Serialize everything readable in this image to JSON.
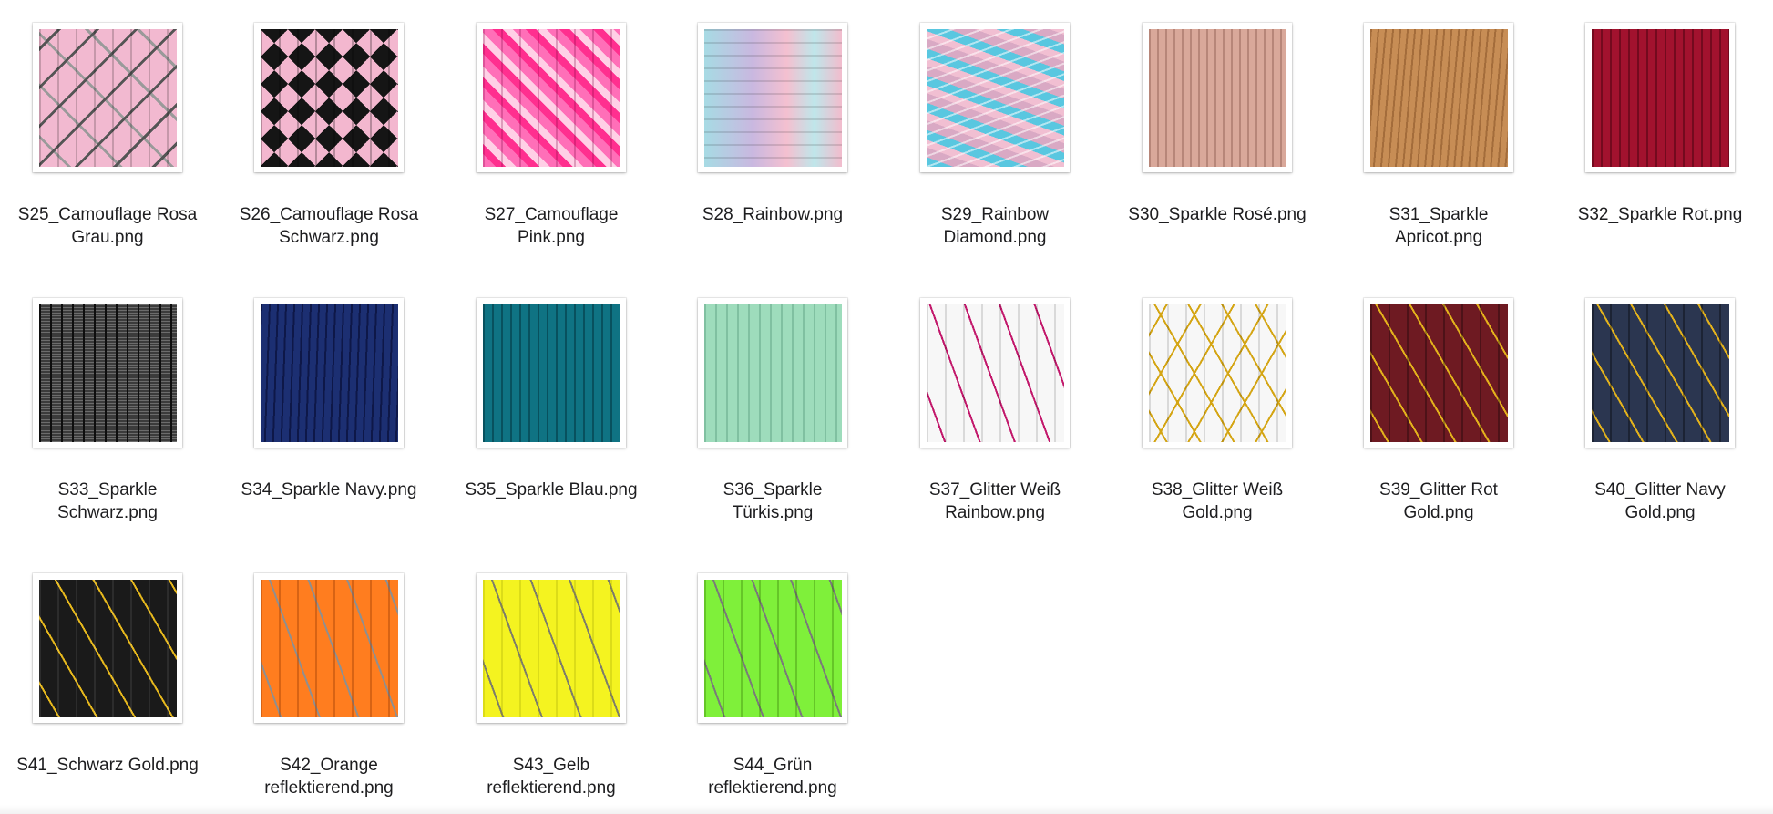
{
  "files": [
    {
      "name": "S25_Camouflage Rosa\nGrau.png",
      "thumbnail": "camouflage-rosa-grau-cord"
    },
    {
      "name": "S26_Camouflage Rosa\nSchwarz.png",
      "thumbnail": "camouflage-rosa-schwarz-cord"
    },
    {
      "name": "S27_Camouflage\nPink.png",
      "thumbnail": "camouflage-pink-cord"
    },
    {
      "name": "S28_Rainbow.png",
      "thumbnail": "rainbow-cord"
    },
    {
      "name": "S29_Rainbow\nDiamond.png",
      "thumbnail": "rainbow-diamond-cord"
    },
    {
      "name": "S30_Sparkle Rosé.png",
      "thumbnail": "sparkle-rose-cord"
    },
    {
      "name": "S31_Sparkle\nApricot.png",
      "thumbnail": "sparkle-apricot-cord"
    },
    {
      "name": "S32_Sparkle Rot.png",
      "thumbnail": "sparkle-rot-cord"
    },
    {
      "name": "S33_Sparkle\nSchwarz.png",
      "thumbnail": "sparkle-schwarz-cord"
    },
    {
      "name": "S34_Sparkle Navy.png",
      "thumbnail": "sparkle-navy-cord"
    },
    {
      "name": "S35_Sparkle Blau.png",
      "thumbnail": "sparkle-blau-cord"
    },
    {
      "name": "S36_Sparkle\nTürkis.png",
      "thumbnail": "sparkle-tuerkis-cord"
    },
    {
      "name": "S37_Glitter Weiß\nRainbow.png",
      "thumbnail": "glitter-weiss-rainbow-cord"
    },
    {
      "name": "S38_Glitter Weiß\nGold.png",
      "thumbnail": "glitter-weiss-gold-cord"
    },
    {
      "name": "S39_Glitter Rot\nGold.png",
      "thumbnail": "glitter-rot-gold-cord"
    },
    {
      "name": "S40_Glitter Navy\nGold.png",
      "thumbnail": "glitter-navy-gold-cord"
    },
    {
      "name": "S41_Schwarz Gold.png",
      "thumbnail": "schwarz-gold-cord"
    },
    {
      "name": "S42_Orange\nreflektierend.png",
      "thumbnail": "orange-reflektierend-cord"
    },
    {
      "name": "S43_Gelb\nreflektierend.png",
      "thumbnail": "gelb-reflektierend-cord"
    },
    {
      "name": "S44_Grün\nreflektierend.png",
      "thumbnail": "gruen-reflektierend-cord"
    }
  ]
}
